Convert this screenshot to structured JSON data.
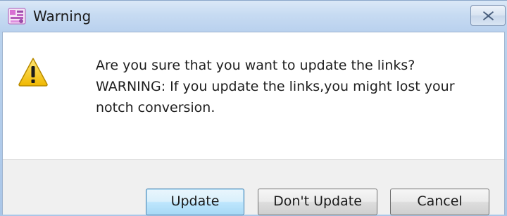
{
  "window": {
    "title": "Warning",
    "app_icon": "application-icon",
    "close_icon": "close-icon"
  },
  "dialog": {
    "icon": "warning-icon",
    "message_lines": [
      "Are you sure that you want to update the links?",
      "WARNING: If you update the links,you might lost your",
      "notch conversion."
    ]
  },
  "buttons": {
    "update": "Update",
    "dont_update": "Don't Update",
    "cancel": "Cancel"
  },
  "colors": {
    "title_bar": "#c7dbf2",
    "footer": "#f0f0f0",
    "default_button_border": "#3c7fb1",
    "warning_yellow": "#f2c21a"
  }
}
